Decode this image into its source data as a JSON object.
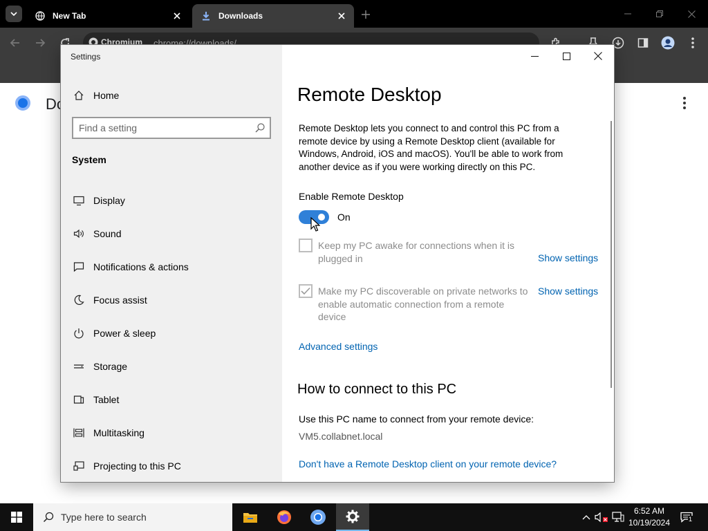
{
  "browser": {
    "tabs": [
      {
        "label": "New Tab",
        "active": false
      },
      {
        "label": "Downloads",
        "active": true
      }
    ],
    "omnibox": {
      "chip": "Chromium",
      "url": "chrome://downloads/"
    },
    "page": {
      "title_partial": "Do"
    }
  },
  "settings": {
    "window_title": "Settings",
    "home_label": "Home",
    "search": {
      "placeholder": "Find a setting"
    },
    "section_label": "System",
    "nav_items": [
      {
        "label": "Display",
        "icon": "monitor-icon"
      },
      {
        "label": "Sound",
        "icon": "speaker-icon"
      },
      {
        "label": "Notifications & actions",
        "icon": "notification-icon"
      },
      {
        "label": "Focus assist",
        "icon": "moon-icon"
      },
      {
        "label": "Power & sleep",
        "icon": "power-icon"
      },
      {
        "label": "Storage",
        "icon": "storage-icon"
      },
      {
        "label": "Tablet",
        "icon": "tablet-icon"
      },
      {
        "label": "Multitasking",
        "icon": "multitasking-icon"
      },
      {
        "label": "Projecting to this PC",
        "icon": "projector-icon"
      }
    ],
    "content": {
      "title": "Remote Desktop",
      "description": "Remote Desktop lets you connect to and control this PC from a remote device by using a Remote Desktop client (available for Windows, Android, iOS and macOS). You'll be able to work from another device as if you were working directly on this PC.",
      "enable_label": "Enable Remote Desktop",
      "toggle": {
        "state": "On",
        "on": true
      },
      "options": [
        {
          "text": "Keep my PC awake for connections when it is plugged in",
          "checked": false,
          "link": "Show settings"
        },
        {
          "text": "Make my PC discoverable on private networks to enable automatic connection from a remote device",
          "checked": true,
          "link": "Show settings"
        }
      ],
      "advanced_link": "Advanced settings",
      "how_to_title": "How to connect to this PC",
      "pc_name_label": "Use this PC name to connect from your remote device:",
      "pc_name": "VM5.collabnet.local",
      "client_link": "Don't have a Remote Desktop client on your remote device?"
    }
  },
  "taskbar": {
    "search_placeholder": "Type here to search",
    "apps": [
      "file-explorer-icon",
      "firefox-icon",
      "chromium-icon",
      "settings-gear-icon"
    ],
    "clock": {
      "time": "6:52 AM",
      "date": "10/19/2024"
    },
    "notification_count": "1"
  },
  "colors": {
    "accent": "#2f80d8",
    "link": "#0063b1",
    "sidebar": "#f0f0f0",
    "taskbar": "#101010",
    "tabstrip": "#000000",
    "toolbar": "#3c3c3c"
  }
}
